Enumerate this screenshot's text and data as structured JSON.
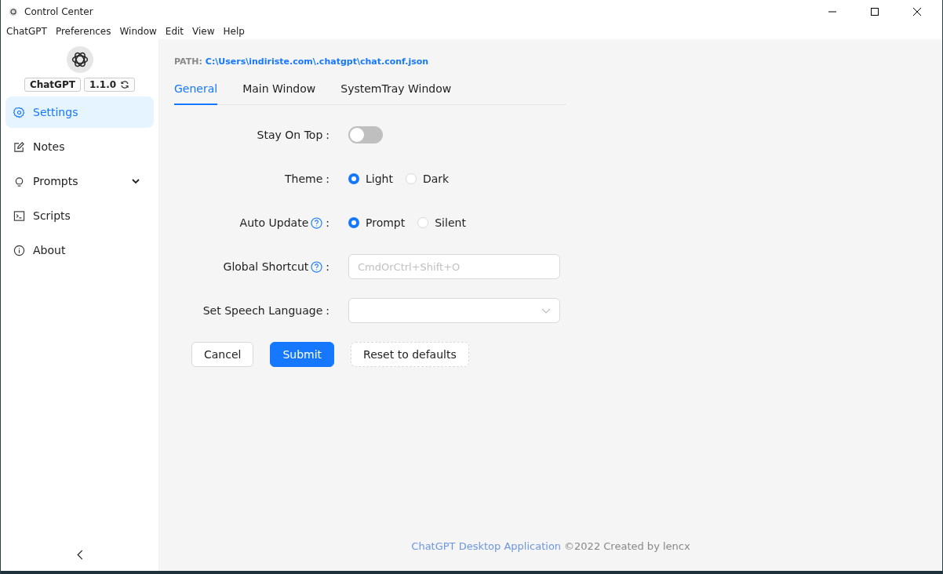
{
  "window": {
    "title": "Control Center"
  },
  "menu": [
    "ChatGPT",
    "Preferences",
    "Window",
    "Edit",
    "View",
    "Help"
  ],
  "sidebar": {
    "app_name": "ChatGPT",
    "version": "1.1.0",
    "items": [
      {
        "label": "Settings",
        "selected": true,
        "expandable": false
      },
      {
        "label": "Notes",
        "selected": false,
        "expandable": false
      },
      {
        "label": "Prompts",
        "selected": false,
        "expandable": true
      },
      {
        "label": "Scripts",
        "selected": false,
        "expandable": false
      },
      {
        "label": "About",
        "selected": false,
        "expandable": false
      }
    ]
  },
  "path": {
    "label": "PATH:",
    "value": "C:\\Users\\indiriste.com\\.chatgpt\\chat.conf.json"
  },
  "tabs": [
    {
      "label": "General",
      "selected": true
    },
    {
      "label": "Main Window",
      "selected": false
    },
    {
      "label": "SystemTray Window",
      "selected": false
    }
  ],
  "form": [
    {
      "kind": "toggle",
      "label": "Stay On Top",
      "colon": ":",
      "help": false,
      "on": false
    },
    {
      "kind": "radio",
      "label": "Theme",
      "colon": ":",
      "help": false,
      "options": [
        {
          "label": "Light",
          "selected": true
        },
        {
          "label": "Dark",
          "selected": false
        }
      ]
    },
    {
      "kind": "radio",
      "label": "Auto Update",
      "colon": ":",
      "help": true,
      "options": [
        {
          "label": "Prompt",
          "selected": true
        },
        {
          "label": "Silent",
          "selected": false
        }
      ]
    },
    {
      "kind": "input",
      "label": "Global Shortcut",
      "colon": ":",
      "help": true,
      "placeholder": "CmdOrCtrl+Shift+O"
    },
    {
      "kind": "select",
      "label": "Set Speech Language",
      "colon": ":",
      "help": false
    }
  ],
  "buttons": [
    {
      "label": "Cancel",
      "kind": "default"
    },
    {
      "label": "Submit",
      "kind": "primary"
    },
    {
      "label": "Reset to defaults",
      "kind": "dashed"
    }
  ],
  "footer": {
    "link": "ChatGPT Desktop Application",
    "text": "©2022 Created by lencx"
  }
}
